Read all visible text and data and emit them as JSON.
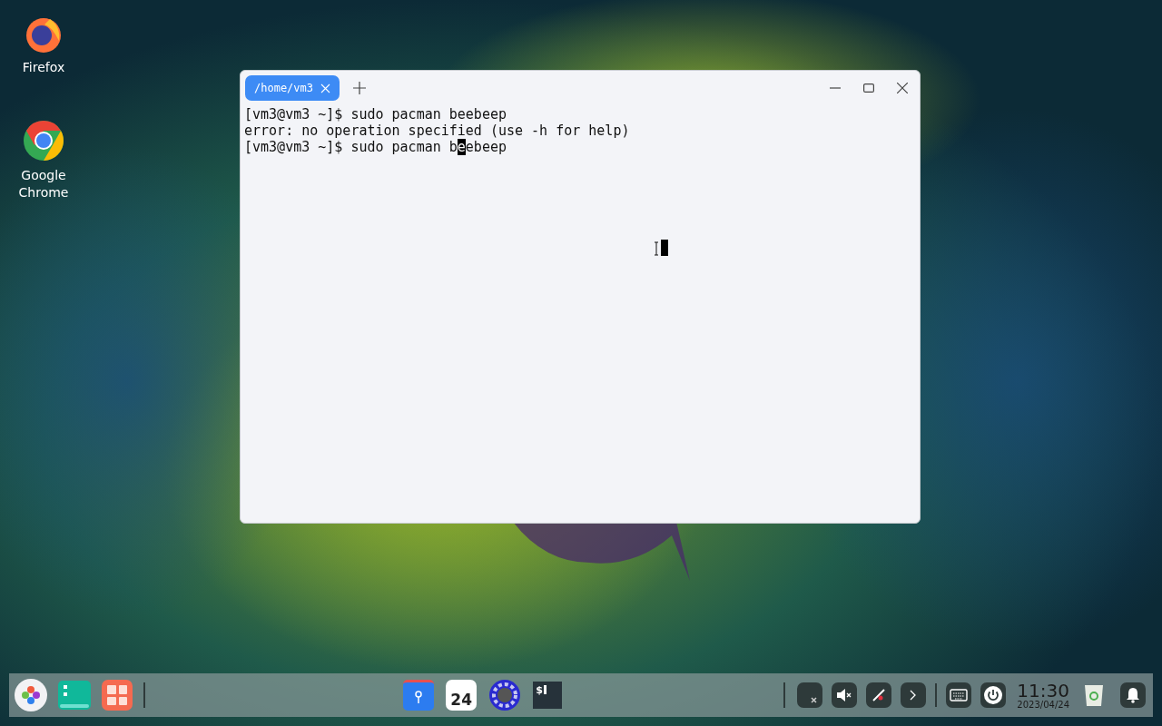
{
  "desktop_icons": [
    {
      "kind": "firefox",
      "label": "Firefox"
    },
    {
      "kind": "chrome",
      "label": "Google Chrome"
    }
  ],
  "terminal": {
    "tabs": [
      {
        "label": "/home/vm3",
        "selected": true
      }
    ],
    "lines": [
      {
        "text": "[vm3@vm3 ~]$ sudo pacman beebeep"
      },
      {
        "text": "error: no operation specified (use -h for help)"
      },
      {
        "text": "[vm3@vm3 ~]$ sudo pacman b",
        "cursor_char": "e",
        "text_after": "ebeep"
      }
    ]
  },
  "taskbar": {
    "left": [
      {
        "kind": "launcher"
      },
      {
        "kind": "multitask"
      },
      {
        "kind": "apps"
      }
    ],
    "center": [
      {
        "kind": "files"
      },
      {
        "kind": "calendar",
        "text": "24"
      },
      {
        "kind": "settings"
      },
      {
        "kind": "terminal",
        "text": "$"
      }
    ],
    "tray": [
      {
        "kind": "network"
      },
      {
        "kind": "sound"
      },
      {
        "kind": "pen"
      },
      {
        "kind": "expand"
      },
      {
        "kind": "keyboard"
      },
      {
        "kind": "power"
      }
    ],
    "clock": {
      "time": "11:30",
      "date": "2023/04/24"
    }
  }
}
